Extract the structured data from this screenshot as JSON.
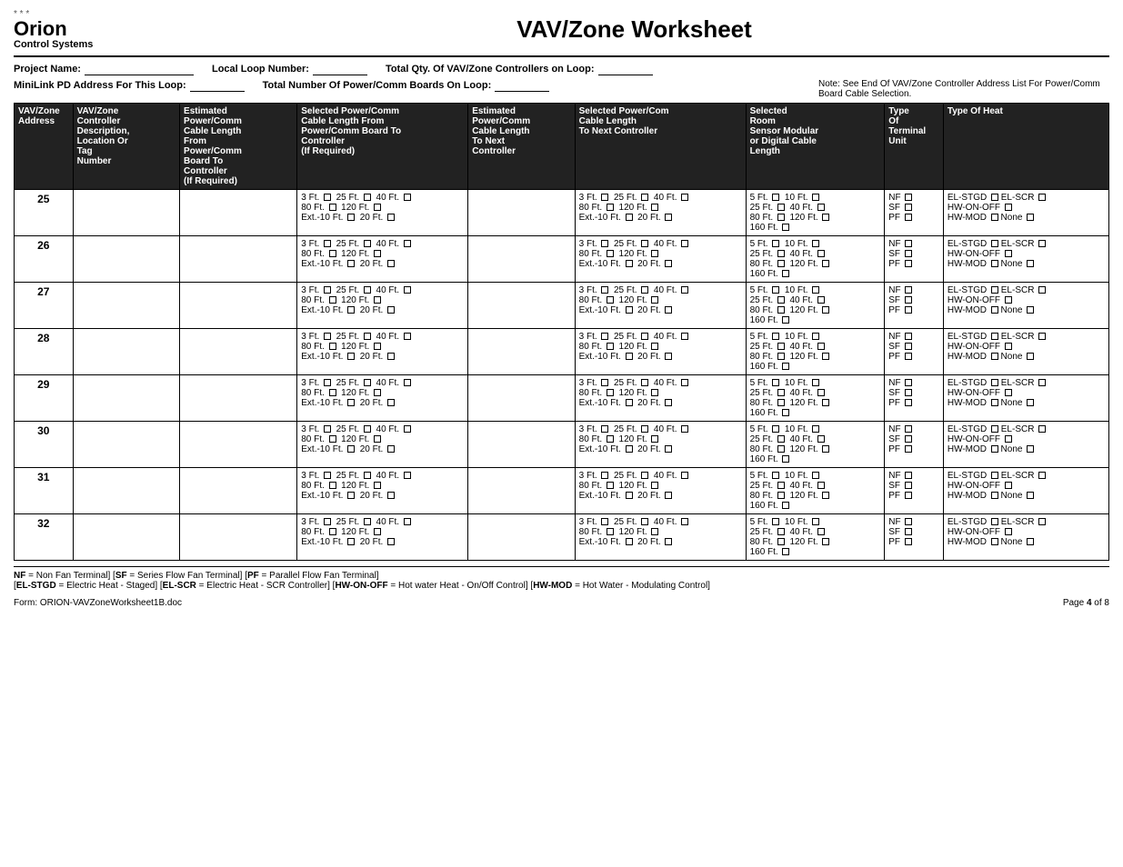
{
  "header": {
    "logo_stars": "* * *",
    "logo_orion": "Orion",
    "logo_subtitle": "Control Systems",
    "title": "VAV/Zone Worksheet",
    "project_name_label": "Project Name:",
    "local_loop_label": "Local Loop Number:",
    "total_qty_label": "Total Qty. Of VAV/Zone Controllers  on Loop:",
    "minilink_label": "MiniLink PD Address For This Loop:",
    "total_boards_label": "Total Number Of Power/Comm Boards On Loop:",
    "note_text": "Note: See End Of VAV/Zone Controller Address List For Power/Comm Board Cable Selection."
  },
  "columns": [
    "VAV/Zone Address",
    "VAV/Zone Controller Description, Location Or Tag Number",
    "Estimated Power/Comm Cable Length From Power/Comm Board To Controller (If Required)",
    "Selected Power/Comm Cable Length From Power/Comm Board To Controller (If Required)",
    "Estimated Power/Comm Cable Length To Next Controller",
    "Selected Power/Com Cable Length To Next Controller",
    "Selected Room Sensor Modular or Digital Cable Length",
    "Type Of Terminal Unit",
    "Type Of Heat"
  ],
  "cable_options": "3 Ft.   25 Ft.   40 Ft.   80 Ft.   120 Ft.   Ext.-10 Ft.   20 Ft.",
  "sensor_options": "5 Ft.   10 Ft.   25 Ft.   40 Ft.   80 Ft.   120 Ft.   160 Ft.",
  "terminal_options": "NF   SF   PF",
  "heat_options": "EL-STGD   EL-SCR   HW-ON-OFF   HW-MOD   None",
  "rows": [
    {
      "address": "25"
    },
    {
      "address": "26"
    },
    {
      "address": "27"
    },
    {
      "address": "28"
    },
    {
      "address": "29"
    },
    {
      "address": "30"
    },
    {
      "address": "31"
    },
    {
      "address": "32"
    }
  ],
  "legend": {
    "line1": "NF = Non Fan Terminal] [SF = Series Flow Fan Terminal] [PF = Parallel Flow Fan Terminal]",
    "line2": "[EL-STGD = Electric Heat  - Staged] [EL-SCR = Electric Heat  - SCR Controller] [HW-ON-OFF = Hot water Heat  - On/Off Control] [HW-MOD = Hot Water - Modulating Control]"
  },
  "footer": {
    "form_name": "Form: ORION-VAVZoneWorksheet1B.doc",
    "page_label": "Page 4 of 8"
  }
}
